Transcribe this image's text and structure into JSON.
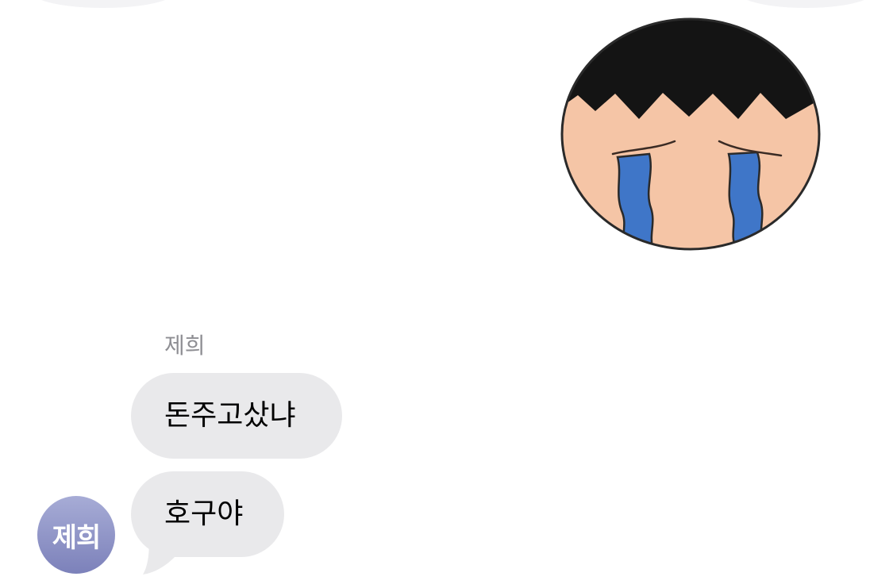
{
  "conversation": {
    "sender_name": "제희",
    "messages": [
      {
        "text": "돈주고샀냐"
      },
      {
        "text": "호구야"
      }
    ],
    "avatar_text": "제희"
  },
  "sticker": {
    "icon": "crying-face-sticker-icon"
  },
  "colors": {
    "background": "#ffffff",
    "bubble_incoming": "#e9e9eb",
    "sender_name": "#8e8e93",
    "avatar_gradient_top": "#a7acd6",
    "avatar_gradient_bottom": "#7c81ba",
    "sticker_skin": "#f5c5a6",
    "sticker_hair": "#141414",
    "sticker_tears": "#3f76c8"
  }
}
